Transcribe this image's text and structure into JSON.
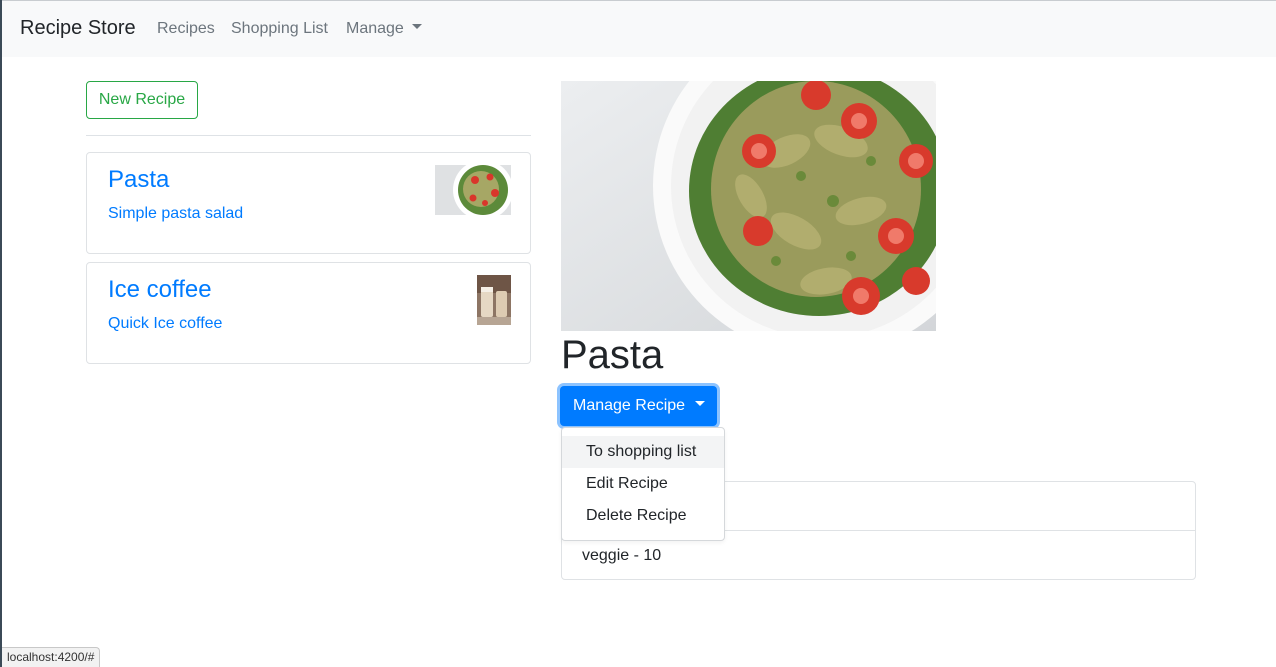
{
  "navbar": {
    "brand": "Recipe Store",
    "links": {
      "recipes": "Recipes",
      "shopping_list": "Shopping List",
      "manage": "Manage"
    }
  },
  "recipe_list": {
    "new_button": "New Recipe",
    "items": [
      {
        "name": "Pasta",
        "description": "Simple pasta salad",
        "image": "pasta-salad-thumbnail"
      },
      {
        "name": "Ice coffee",
        "description": "Quick Ice coffee",
        "image": "ice-coffee-thumbnail"
      }
    ]
  },
  "recipe_detail": {
    "name": "Pasta",
    "image": "pasta-salad-photo",
    "manage_button": "Manage Recipe",
    "dropdown": {
      "items": [
        "To shopping list",
        "Edit Recipe",
        "Delete Recipe"
      ],
      "highlighted_index": 0
    },
    "ingredients": [
      "",
      "veggie - 10"
    ]
  },
  "status_bar": {
    "url": "localhost:4200/#"
  },
  "colors": {
    "primary": "#007bff",
    "success": "#28a745",
    "navbar_bg": "#f8f9fa",
    "muted": "#6c757d"
  }
}
